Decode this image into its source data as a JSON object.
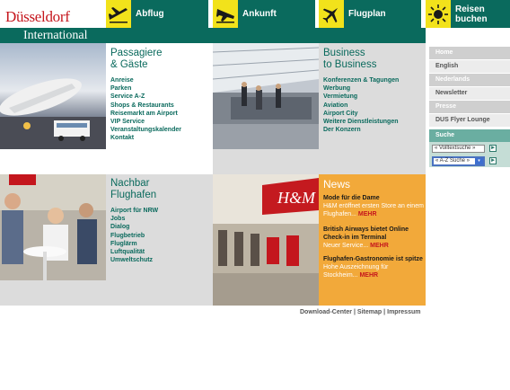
{
  "header": {
    "logo_line1": "Düsseldorf",
    "logo_line2": "International",
    "nav": [
      {
        "label": "Abflug",
        "icon": "departure-plane-icon"
      },
      {
        "label": "Ankunft",
        "icon": "arrival-plane-icon"
      },
      {
        "label": "Flugplan",
        "icon": "plane-icon"
      },
      {
        "label_line1": "Reisen",
        "label_line2": "buchen",
        "icon": "sun-icon"
      }
    ]
  },
  "panels": {
    "passagiere": {
      "title_line1": "Passagiere",
      "title_line2": "& Gäste",
      "links": [
        "Anreise",
        "Parken",
        "Service A-Z",
        "Shops & Restaurants",
        "Reisemarkt am Airport",
        "VIP Service",
        "Veranstaltungskalender",
        "Kontakt"
      ]
    },
    "business": {
      "title_line1": "Business",
      "title_line2": "to Business",
      "links": [
        "Konferenzen & Tagungen",
        "Werbung",
        "Vermietung",
        "Aviation",
        "Airport City",
        "Weitere Dienstleistungen",
        "Der Konzern"
      ]
    },
    "nachbar": {
      "title_line1": "Nachbar",
      "title_line2": "Flughafen",
      "links": [
        "Airport für NRW",
        "Jobs",
        "Dialog",
        "Flugbetrieb",
        "Fluglärm",
        "Luftqualität",
        "Umweltschutz"
      ]
    }
  },
  "news": {
    "title": "News",
    "items": [
      {
        "headline": "Mode für die Dame",
        "text": "H&M eröffnet ersten Store an einem Flughafen...",
        "more": "MEHR"
      },
      {
        "headline": "British Airways bietet Online Check-in im Terminal",
        "text": "Neuer Service...",
        "more": "MEHR"
      },
      {
        "headline": "Flughafen-Gastronomie ist spitze",
        "text": "Hohe Auszeichnung für Stockheim...",
        "more": "MEHR"
      }
    ]
  },
  "footer": {
    "links": [
      "Download-Center",
      "Sitemap",
      "Impressum"
    ]
  },
  "sidebar": {
    "items": [
      "Home",
      "English",
      "Nederlands",
      "Newsletter",
      "Presse",
      "DUS Flyer Lounge"
    ],
    "search_label": "Suche",
    "select1": "« Volltextsuche »",
    "select2": "« A-Z Suche »"
  },
  "colors": {
    "brand_green": "#0a6a5d",
    "brand_red": "#c5161d",
    "icon_yellow": "#f2e21b",
    "news_orange": "#f2a93a"
  }
}
